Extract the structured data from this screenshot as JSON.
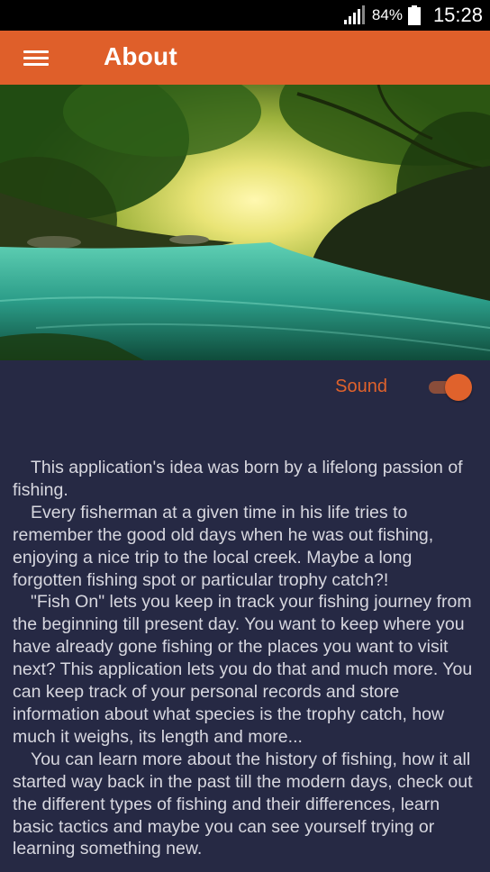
{
  "status_bar": {
    "battery": "84%",
    "time": "15:28"
  },
  "app_bar": {
    "title": "About",
    "menu_icon": "hamburger-menu-icon"
  },
  "hero_image": {
    "description_icon": "river-landscape-image"
  },
  "settings": {
    "sound_label": "Sound",
    "sound_enabled": true,
    "accent_color": "#e0622c"
  },
  "about": {
    "paragraphs": [
      "This application's idea was born by a lifelong passion of fishing.",
      "Every fisherman at a given time in his life tries to remember the good old days when he was out fishing, enjoying a nice trip to the local creek. Maybe a long forgotten fishing spot or particular trophy catch?!",
      "\"Fish On\" lets you keep in track your fishing journey from the beginning till present day. You want to keep where you have already gone fishing or the places you want to visit next? This application lets you do that and much more. You can keep track of your personal records and store information about what species is the trophy catch, how much it weighs, its length and more...",
      "You can learn more about the history of fishing, how it all started way back in the past till the modern days, check out the different types of fishing and their differences, learn basic tactics and maybe you can see yourself trying or learning something new."
    ]
  },
  "colors": {
    "app_bar": "#df5f2a",
    "background": "#262944",
    "text": "#d7d7df"
  }
}
